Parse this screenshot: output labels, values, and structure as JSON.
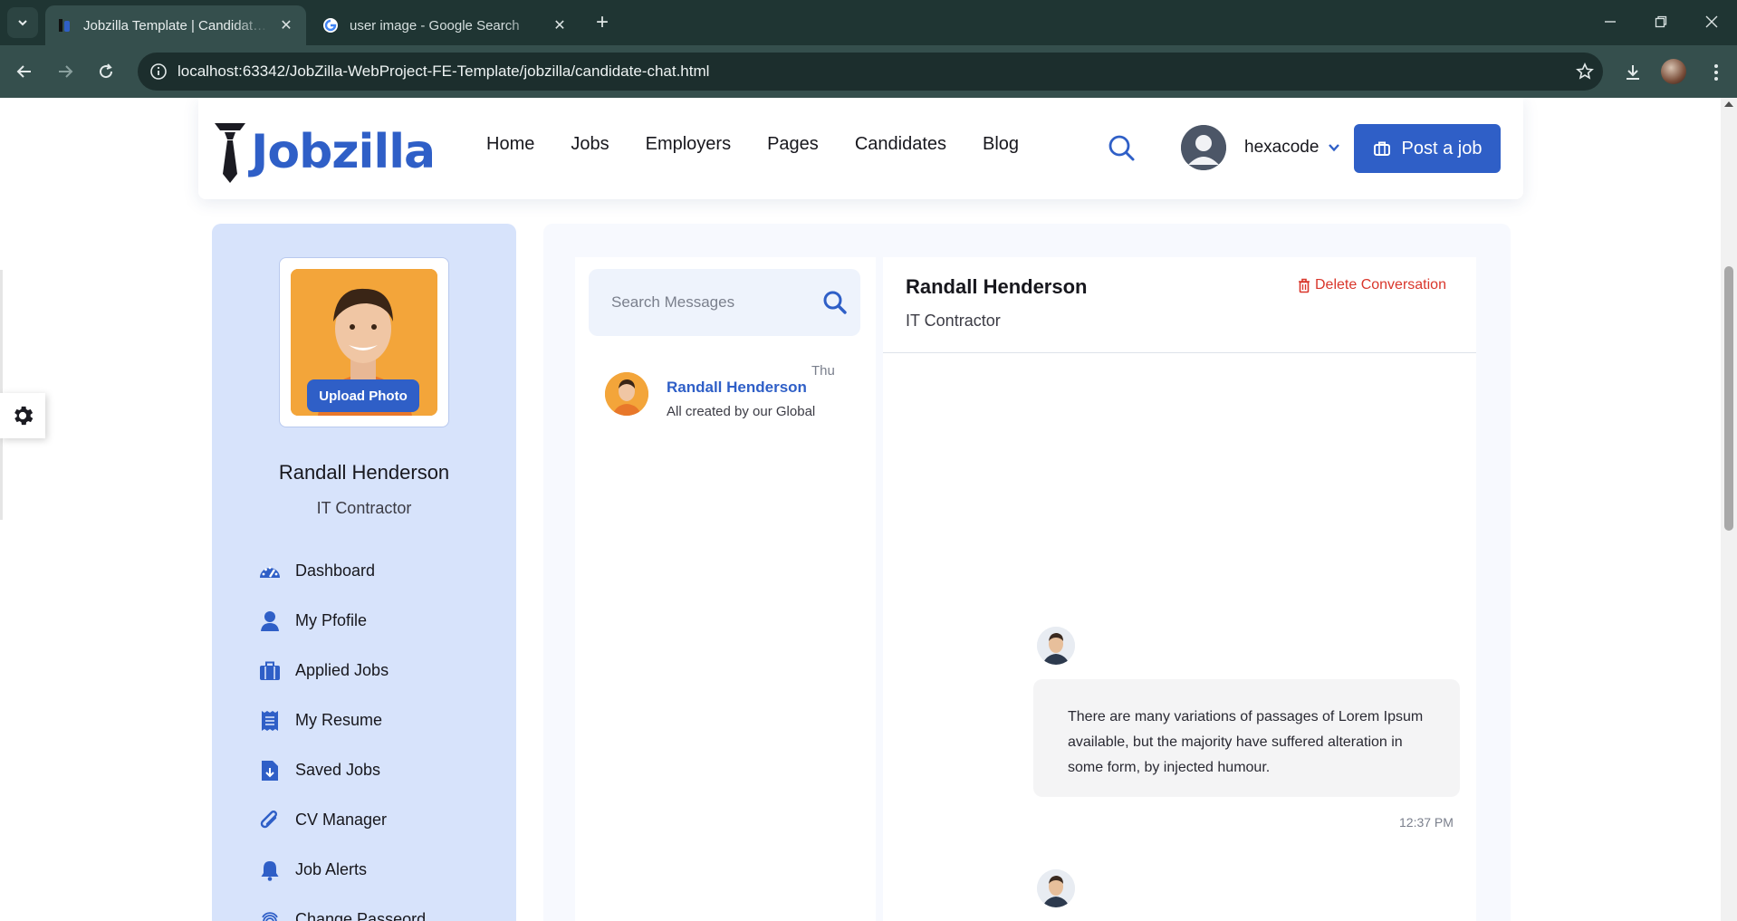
{
  "browser": {
    "tabs": [
      {
        "title": "Jobzilla Template | Candidate dashboard",
        "active": true
      },
      {
        "title": "user image - Google Search",
        "active": false
      }
    ],
    "url": "localhost:63342/JobZilla-WebProject-FE-Template/jobzilla/candidate-chat.html"
  },
  "header": {
    "logo_text": "Jobzilla",
    "nav": [
      "Home",
      "Jobs",
      "Employers",
      "Pages",
      "Candidates",
      "Blog"
    ],
    "username": "hexacode",
    "post_job_label": "Post a job"
  },
  "profile": {
    "upload_label": "Upload Photo",
    "name": "Randall Henderson",
    "role": "IT Contractor",
    "menu": [
      {
        "label": "Dashboard",
        "icon": "gauge-icon"
      },
      {
        "label": "My Pfofile",
        "icon": "user-icon"
      },
      {
        "label": "Applied Jobs",
        "icon": "suitcase-icon"
      },
      {
        "label": "My Resume",
        "icon": "receipt-icon"
      },
      {
        "label": "Saved Jobs",
        "icon": "file-download-icon"
      },
      {
        "label": "CV Manager",
        "icon": "paperclip-icon"
      },
      {
        "label": "Job Alerts",
        "icon": "bell-icon"
      },
      {
        "label": "Change Passeord",
        "icon": "fingerprint-icon"
      }
    ]
  },
  "messages": {
    "search_placeholder": "Search Messages",
    "conversations": [
      {
        "name": "Randall Henderson",
        "preview": "All created by our Global",
        "day": "Thu"
      }
    ]
  },
  "chat": {
    "name": "Randall Henderson",
    "role": "IT Contractor",
    "delete_label": "Delete Conversation",
    "message_text": "There are many variations of passages of Lorem Ipsum available, but the majority have suffered alteration in some form, by injected humour.",
    "message_time": "12:37 PM"
  },
  "colors": {
    "brand": "#2f5fc7",
    "danger": "#d9362b",
    "sidebar_bg": "#d7e3fb"
  }
}
